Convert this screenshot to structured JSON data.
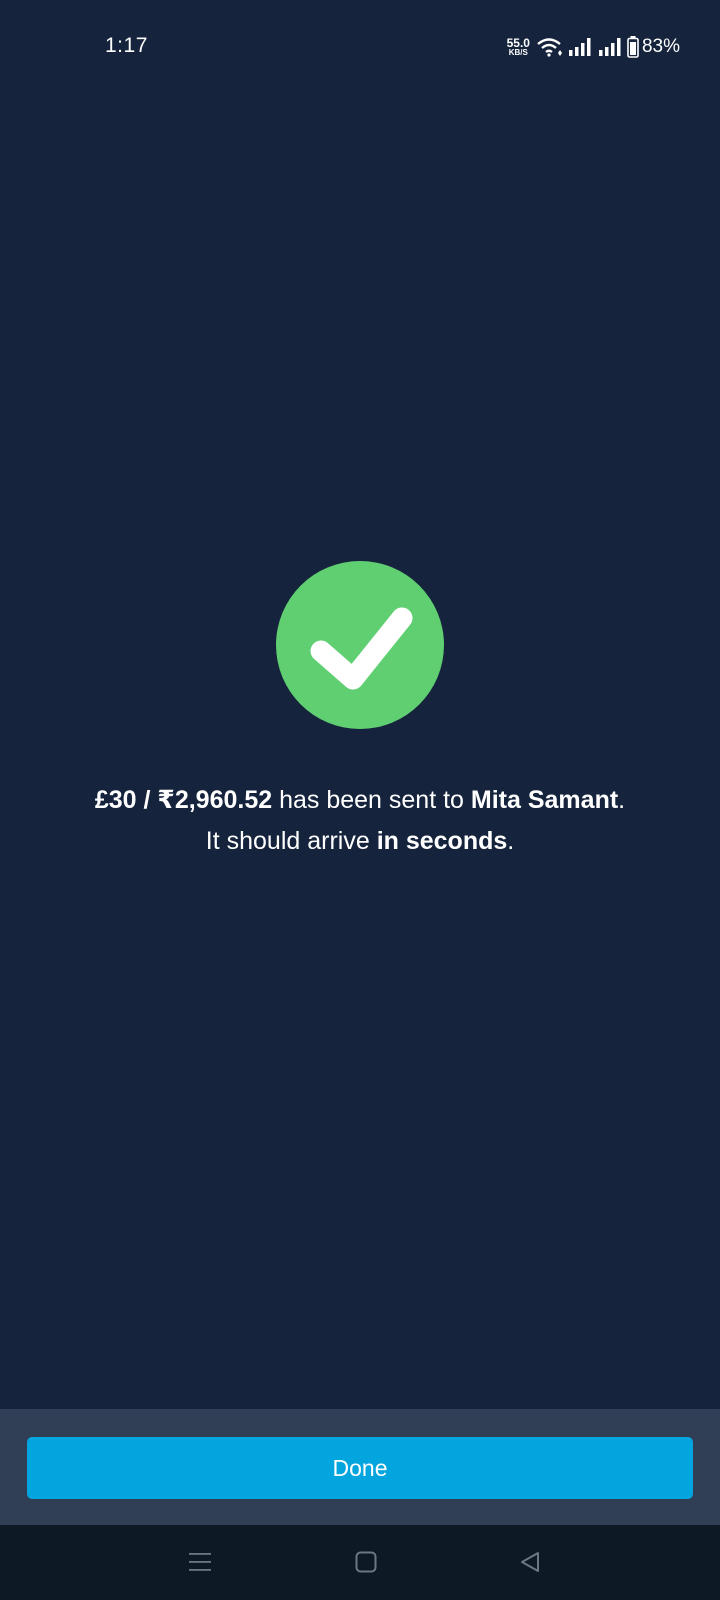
{
  "status_bar": {
    "time": "1:17",
    "net_speed_value": "55.0",
    "net_speed_unit": "KB/S",
    "battery_percent": "83%"
  },
  "success": {
    "icon": "checkmark-circle-icon",
    "color": "#5fcf72"
  },
  "message": {
    "amount": "£30 / ₹2,960.52",
    "text1": " has been sent to ",
    "recipient": "Mita Samant",
    "text2": ". It should arrive ",
    "eta": "in seconds",
    "text3": "."
  },
  "actions": {
    "done_label": "Done",
    "accent": "#03a5de"
  },
  "nav": {
    "recents": "menu-icon",
    "home": "home-square-icon",
    "back": "back-triangle-icon"
  }
}
